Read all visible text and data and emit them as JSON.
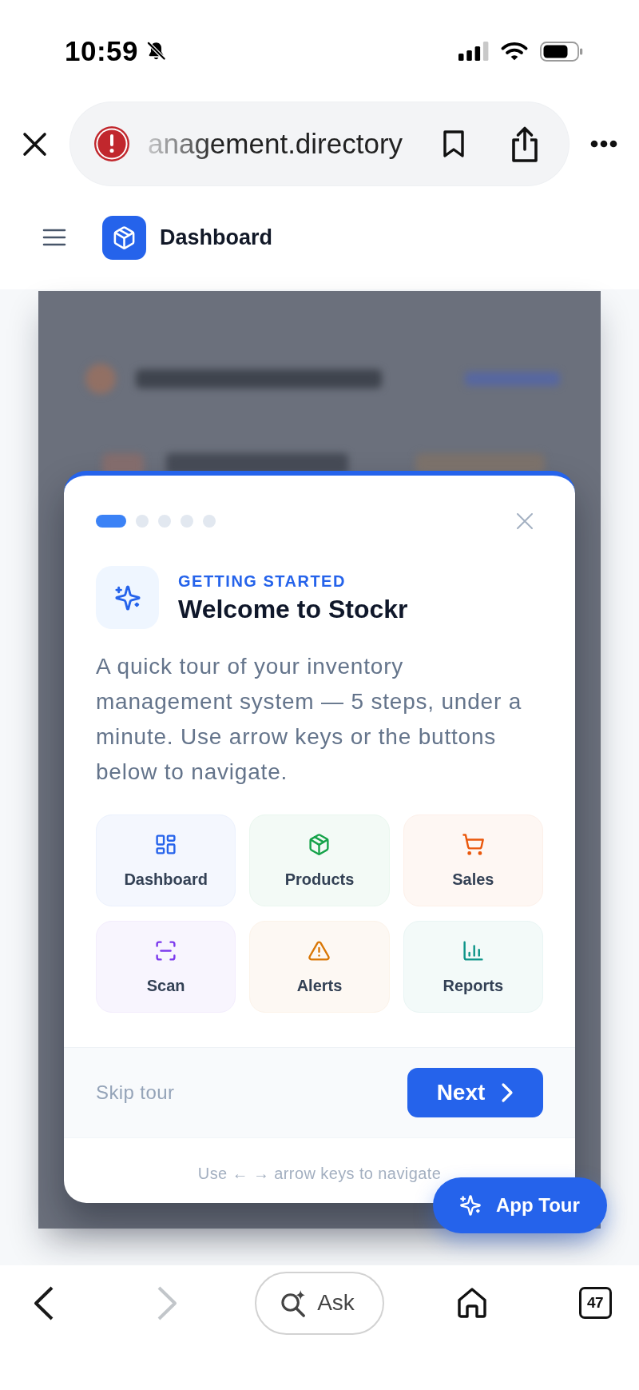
{
  "status_bar": {
    "time": "10:59",
    "silent": true
  },
  "browser": {
    "url": "anagement.directory"
  },
  "header": {
    "title": "Dashboard"
  },
  "tour": {
    "steps": [
      {
        "selected": true
      },
      {
        "selected": false
      },
      {
        "selected": false
      },
      {
        "selected": false
      },
      {
        "selected": false
      }
    ],
    "eyebrow": "GETTING STARTED",
    "title": "Welcome to Stockr",
    "description": "A quick tour of your inventory management system — 5 steps, under a minute. Use arrow keys or the buttons below to navigate.",
    "features": [
      {
        "label": "Dashboard",
        "color": "#2563eb"
      },
      {
        "label": "Products",
        "color": "#16a34a"
      },
      {
        "label": "Sales",
        "color": "#ea580c"
      },
      {
        "label": "Scan",
        "color": "#7c3aed"
      },
      {
        "label": "Alerts",
        "color": "#d97706"
      },
      {
        "label": "Reports",
        "color": "#0d9488"
      }
    ],
    "skip": "Skip tour",
    "next": "Next",
    "hint": "Use ← → arrow keys to navigate"
  },
  "app_tour": {
    "label": "App Tour"
  },
  "toolbar": {
    "back_disabled": false,
    "forward_disabled": true,
    "ask": "Ask",
    "tab_count": "47"
  }
}
